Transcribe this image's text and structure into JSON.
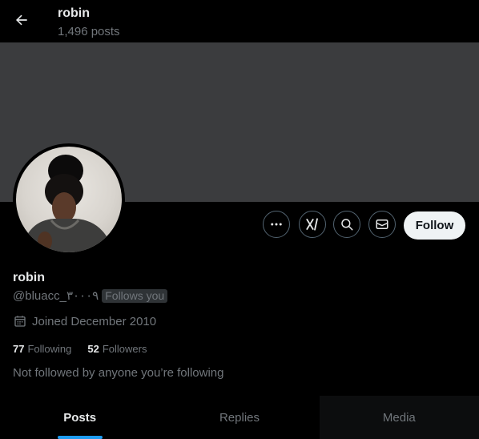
{
  "header": {
    "title": "robin",
    "subtitle": "1,496 posts"
  },
  "profile": {
    "name": "robin",
    "handle": "@bluacc_٣٠٠٠٩",
    "follows_you": "Follows you",
    "joined": "Joined December 2010",
    "following_count": "77",
    "following_label": "Following",
    "followers_count": "52",
    "followers_label": "Followers",
    "not_followed_text": "Not followed by anyone you’re following"
  },
  "actions": {
    "icons": [
      "more-icon",
      "grok-icon",
      "search-icon",
      "message-icon"
    ],
    "follow_label": "Follow"
  },
  "tabs": [
    {
      "label": "Posts",
      "active": true
    },
    {
      "label": "Replies",
      "active": false
    },
    {
      "label": "Media",
      "active": false
    }
  ],
  "colors": {
    "accent": "#1d9bf0",
    "banner": "#3b3c3e",
    "muted": "#71767b"
  }
}
